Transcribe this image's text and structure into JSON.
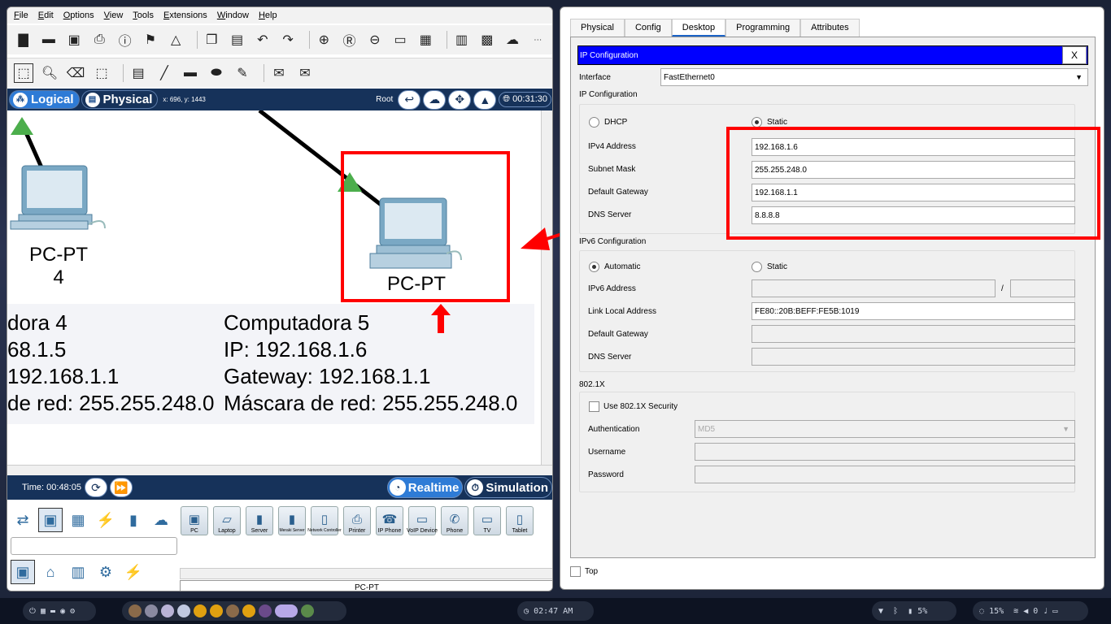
{
  "menu": [
    "File",
    "Edit",
    "Options",
    "View",
    "Tools",
    "Extensions",
    "Window",
    "Help"
  ],
  "modebar": {
    "logical": "Logical",
    "physical": "Physical",
    "coords": "x: 696, y: 1443",
    "root": "Root",
    "clock": "00:31:30"
  },
  "canvas": {
    "pc4_label_line1": "PC-PT",
    "pc4_label_line2": "4",
    "pc5_label": "PC-PT",
    "note_left": [
      "dora 4",
      "68.1.5",
      " 192.168.1.1",
      "de red: 255.255.248.0"
    ],
    "note_right": [
      "Computadora 5",
      "IP: 192.168.1.6",
      "Gateway: 192.168.1.1",
      "Máscara de red: 255.255.248.0"
    ]
  },
  "timebar": {
    "time": "Time: 00:48:05",
    "realtime": "Realtime",
    "simulation": "Simulation"
  },
  "devices": {
    "items": [
      "PC",
      "Laptop",
      "Server",
      "Meraki Server",
      "Network Controller",
      "Printer",
      "IP Phone",
      "VoIP Device",
      "Phone",
      "TV",
      "Tablet"
    ],
    "selected_name": "PC-PT"
  },
  "config": {
    "tabs": [
      "Physical",
      "Config",
      "Desktop",
      "Programming",
      "Attributes"
    ],
    "active_tab": "Desktop",
    "header": "IP Configuration",
    "close": "X",
    "interface_label": "Interface",
    "interface_value": "FastEthernet0",
    "ipv4_section": "IP Configuration",
    "dhcp": "DHCP",
    "static": "Static",
    "ipv4_address_label": "IPv4 Address",
    "ipv4_address": "192.168.1.6",
    "subnet_label": "Subnet Mask",
    "subnet": "255.255.248.0",
    "gateway_label": "Default Gateway",
    "gateway": "192.168.1.1",
    "dns_label": "DNS Server",
    "dns": "8.8.8.8",
    "ipv6_section": "IPv6 Configuration",
    "automatic": "Automatic",
    "static6": "Static",
    "ipv6_address_label": "IPv6 Address",
    "slash": "/",
    "link_local_label": "Link Local Address",
    "link_local": "FE80::20B:BEFF:FE5B:1019",
    "gateway6_label": "Default Gateway",
    "dns6_label": "DNS Server",
    "dot1x_section": "802.1X",
    "use_dot1x": "Use 802.1X Security",
    "auth_label": "Authentication",
    "auth_value": "MD5",
    "username_label": "Username",
    "password_label": "Password",
    "top_label": "Top"
  },
  "taskbar": {
    "clock": "02:47 AM",
    "battery": "5%",
    "cpu": "15%",
    "volume": "0"
  },
  "colors": {
    "ip_header": "#0000ff",
    "annotation_red": "#ff0000",
    "pt_blue": "#16325a"
  }
}
